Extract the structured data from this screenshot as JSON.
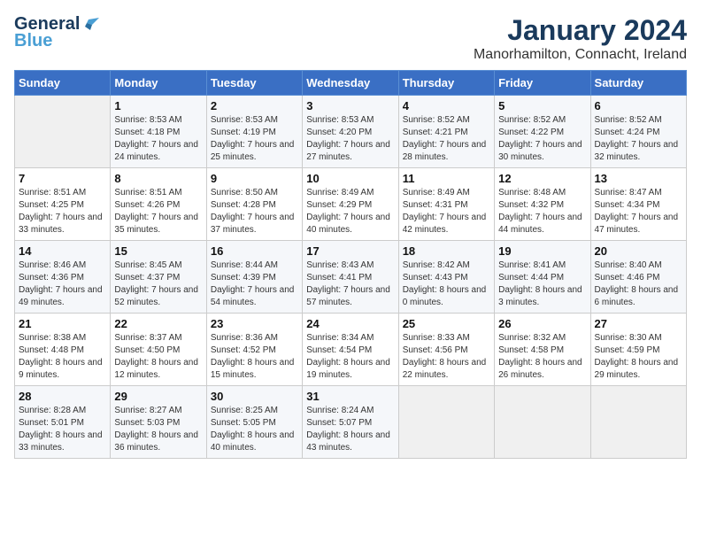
{
  "header": {
    "logo_general": "General",
    "logo_blue": "Blue",
    "month": "January 2024",
    "location": "Manorhamilton, Connacht, Ireland"
  },
  "weekdays": [
    "Sunday",
    "Monday",
    "Tuesday",
    "Wednesday",
    "Thursday",
    "Friday",
    "Saturday"
  ],
  "weeks": [
    [
      {
        "day": "",
        "sunrise": "",
        "sunset": "",
        "daylight": ""
      },
      {
        "day": "1",
        "sunrise": "Sunrise: 8:53 AM",
        "sunset": "Sunset: 4:18 PM",
        "daylight": "Daylight: 7 hours and 24 minutes."
      },
      {
        "day": "2",
        "sunrise": "Sunrise: 8:53 AM",
        "sunset": "Sunset: 4:19 PM",
        "daylight": "Daylight: 7 hours and 25 minutes."
      },
      {
        "day": "3",
        "sunrise": "Sunrise: 8:53 AM",
        "sunset": "Sunset: 4:20 PM",
        "daylight": "Daylight: 7 hours and 27 minutes."
      },
      {
        "day": "4",
        "sunrise": "Sunrise: 8:52 AM",
        "sunset": "Sunset: 4:21 PM",
        "daylight": "Daylight: 7 hours and 28 minutes."
      },
      {
        "day": "5",
        "sunrise": "Sunrise: 8:52 AM",
        "sunset": "Sunset: 4:22 PM",
        "daylight": "Daylight: 7 hours and 30 minutes."
      },
      {
        "day": "6",
        "sunrise": "Sunrise: 8:52 AM",
        "sunset": "Sunset: 4:24 PM",
        "daylight": "Daylight: 7 hours and 32 minutes."
      }
    ],
    [
      {
        "day": "7",
        "sunrise": "Sunrise: 8:51 AM",
        "sunset": "Sunset: 4:25 PM",
        "daylight": "Daylight: 7 hours and 33 minutes."
      },
      {
        "day": "8",
        "sunrise": "Sunrise: 8:51 AM",
        "sunset": "Sunset: 4:26 PM",
        "daylight": "Daylight: 7 hours and 35 minutes."
      },
      {
        "day": "9",
        "sunrise": "Sunrise: 8:50 AM",
        "sunset": "Sunset: 4:28 PM",
        "daylight": "Daylight: 7 hours and 37 minutes."
      },
      {
        "day": "10",
        "sunrise": "Sunrise: 8:49 AM",
        "sunset": "Sunset: 4:29 PM",
        "daylight": "Daylight: 7 hours and 40 minutes."
      },
      {
        "day": "11",
        "sunrise": "Sunrise: 8:49 AM",
        "sunset": "Sunset: 4:31 PM",
        "daylight": "Daylight: 7 hours and 42 minutes."
      },
      {
        "day": "12",
        "sunrise": "Sunrise: 8:48 AM",
        "sunset": "Sunset: 4:32 PM",
        "daylight": "Daylight: 7 hours and 44 minutes."
      },
      {
        "day": "13",
        "sunrise": "Sunrise: 8:47 AM",
        "sunset": "Sunset: 4:34 PM",
        "daylight": "Daylight: 7 hours and 47 minutes."
      }
    ],
    [
      {
        "day": "14",
        "sunrise": "Sunrise: 8:46 AM",
        "sunset": "Sunset: 4:36 PM",
        "daylight": "Daylight: 7 hours and 49 minutes."
      },
      {
        "day": "15",
        "sunrise": "Sunrise: 8:45 AM",
        "sunset": "Sunset: 4:37 PM",
        "daylight": "Daylight: 7 hours and 52 minutes."
      },
      {
        "day": "16",
        "sunrise": "Sunrise: 8:44 AM",
        "sunset": "Sunset: 4:39 PM",
        "daylight": "Daylight: 7 hours and 54 minutes."
      },
      {
        "day": "17",
        "sunrise": "Sunrise: 8:43 AM",
        "sunset": "Sunset: 4:41 PM",
        "daylight": "Daylight: 7 hours and 57 minutes."
      },
      {
        "day": "18",
        "sunrise": "Sunrise: 8:42 AM",
        "sunset": "Sunset: 4:43 PM",
        "daylight": "Daylight: 8 hours and 0 minutes."
      },
      {
        "day": "19",
        "sunrise": "Sunrise: 8:41 AM",
        "sunset": "Sunset: 4:44 PM",
        "daylight": "Daylight: 8 hours and 3 minutes."
      },
      {
        "day": "20",
        "sunrise": "Sunrise: 8:40 AM",
        "sunset": "Sunset: 4:46 PM",
        "daylight": "Daylight: 8 hours and 6 minutes."
      }
    ],
    [
      {
        "day": "21",
        "sunrise": "Sunrise: 8:38 AM",
        "sunset": "Sunset: 4:48 PM",
        "daylight": "Daylight: 8 hours and 9 minutes."
      },
      {
        "day": "22",
        "sunrise": "Sunrise: 8:37 AM",
        "sunset": "Sunset: 4:50 PM",
        "daylight": "Daylight: 8 hours and 12 minutes."
      },
      {
        "day": "23",
        "sunrise": "Sunrise: 8:36 AM",
        "sunset": "Sunset: 4:52 PM",
        "daylight": "Daylight: 8 hours and 15 minutes."
      },
      {
        "day": "24",
        "sunrise": "Sunrise: 8:34 AM",
        "sunset": "Sunset: 4:54 PM",
        "daylight": "Daylight: 8 hours and 19 minutes."
      },
      {
        "day": "25",
        "sunrise": "Sunrise: 8:33 AM",
        "sunset": "Sunset: 4:56 PM",
        "daylight": "Daylight: 8 hours and 22 minutes."
      },
      {
        "day": "26",
        "sunrise": "Sunrise: 8:32 AM",
        "sunset": "Sunset: 4:58 PM",
        "daylight": "Daylight: 8 hours and 26 minutes."
      },
      {
        "day": "27",
        "sunrise": "Sunrise: 8:30 AM",
        "sunset": "Sunset: 4:59 PM",
        "daylight": "Daylight: 8 hours and 29 minutes."
      }
    ],
    [
      {
        "day": "28",
        "sunrise": "Sunrise: 8:28 AM",
        "sunset": "Sunset: 5:01 PM",
        "daylight": "Daylight: 8 hours and 33 minutes."
      },
      {
        "day": "29",
        "sunrise": "Sunrise: 8:27 AM",
        "sunset": "Sunset: 5:03 PM",
        "daylight": "Daylight: 8 hours and 36 minutes."
      },
      {
        "day": "30",
        "sunrise": "Sunrise: 8:25 AM",
        "sunset": "Sunset: 5:05 PM",
        "daylight": "Daylight: 8 hours and 40 minutes."
      },
      {
        "day": "31",
        "sunrise": "Sunrise: 8:24 AM",
        "sunset": "Sunset: 5:07 PM",
        "daylight": "Daylight: 8 hours and 43 minutes."
      },
      {
        "day": "",
        "sunrise": "",
        "sunset": "",
        "daylight": ""
      },
      {
        "day": "",
        "sunrise": "",
        "sunset": "",
        "daylight": ""
      },
      {
        "day": "",
        "sunrise": "",
        "sunset": "",
        "daylight": ""
      }
    ]
  ]
}
